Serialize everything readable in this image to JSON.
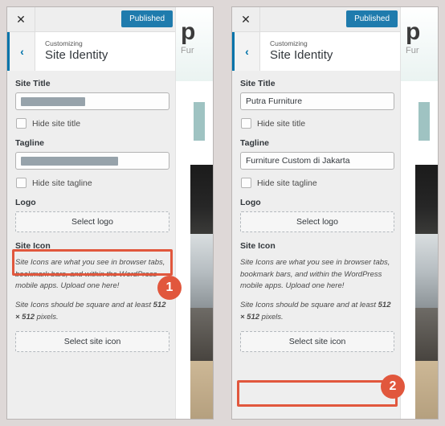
{
  "background_color": "#ded8d7",
  "accent_colors": {
    "publish_blue": "#1f7bad",
    "nav_blue": "#0073aa",
    "annotation_red": "#e1573d",
    "redaction_gray": "#97a3ab"
  },
  "panels": [
    {
      "id": "left",
      "topbar": {
        "close_icon": "close-icon",
        "close_glyph": "✕",
        "publish_label": "Published"
      },
      "section_header": {
        "back_icon": "chevron-left-icon",
        "back_glyph": "‹",
        "kicker": "Customizing",
        "title": "Site Identity"
      },
      "site_title": {
        "label": "Site Title",
        "value": "",
        "redacted": true,
        "hide_checkbox_label": "Hide site title",
        "hide_checked": false
      },
      "tagline": {
        "label": "Tagline",
        "value": "",
        "redacted": true,
        "hide_checkbox_label": "Hide site tagline",
        "hide_checked": false
      },
      "logo": {
        "label": "Logo",
        "button_label": "Select logo",
        "highlighted": true
      },
      "site_icon": {
        "label": "Site Icon",
        "description_1": "Site Icons are what you see in browser tabs, bookmark bars, and within the WordPress mobile apps. Upload one here!",
        "description_2_prefix": "Site Icons should be square and at least ",
        "description_2_bold": "512 × 512",
        "description_2_suffix": " pixels.",
        "button_label": "Select site icon",
        "highlighted": false
      },
      "preview": {
        "logo_text": "p",
        "tagline_text": "Fur"
      },
      "badge": {
        "number": "1",
        "anchored_to": "select-logo-button"
      }
    },
    {
      "id": "right",
      "topbar": {
        "close_icon": "close-icon",
        "close_glyph": "✕",
        "publish_label": "Published"
      },
      "section_header": {
        "back_icon": "chevron-left-icon",
        "back_glyph": "‹",
        "kicker": "Customizing",
        "title": "Site Identity"
      },
      "site_title": {
        "label": "Site Title",
        "value": "Putra Furniture",
        "redacted": false,
        "hide_checkbox_label": "Hide site title",
        "hide_checked": false
      },
      "tagline": {
        "label": "Tagline",
        "value": "Furniture Custom di Jakarta",
        "redacted": false,
        "hide_checkbox_label": "Hide site tagline",
        "hide_checked": false
      },
      "logo": {
        "label": "Logo",
        "button_label": "Select logo",
        "highlighted": false
      },
      "site_icon": {
        "label": "Site Icon",
        "description_1": "Site Icons are what you see in browser tabs, bookmark bars, and within the WordPress mobile apps. Upload one here!",
        "description_2_prefix": "Site Icons should be square and at least ",
        "description_2_bold": "512 × 512",
        "description_2_suffix": " pixels.",
        "button_label": "Select site icon",
        "highlighted": true
      },
      "preview": {
        "logo_text": "p",
        "tagline_text": "Fur"
      },
      "badge": {
        "number": "2",
        "anchored_to": "select-site-icon-button"
      }
    }
  ]
}
